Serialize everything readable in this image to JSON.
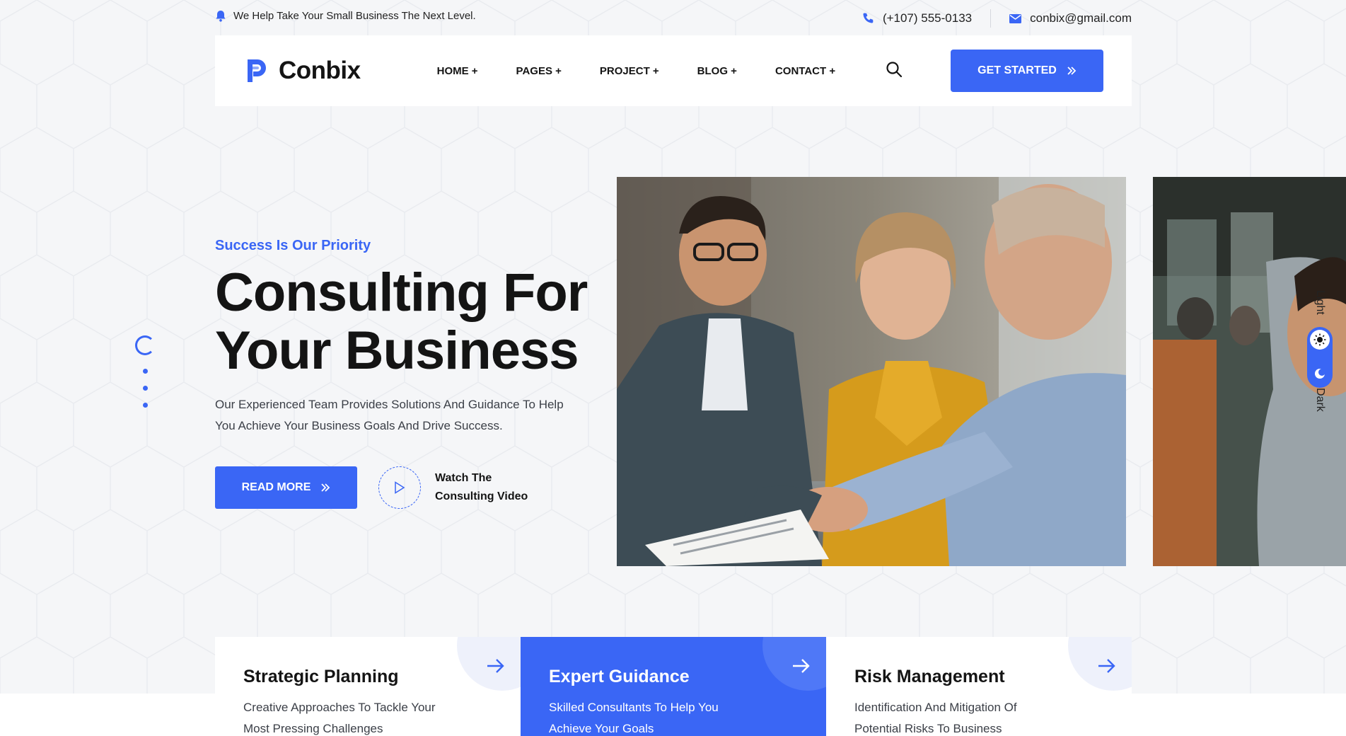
{
  "topbar": {
    "tagline": "We Help Take Your Small Business The Next Level.",
    "phone": "(+107) 555-0133",
    "email": "conbix@gmail.com"
  },
  "header": {
    "logo_text": "Conbix",
    "nav": [
      "HOME +",
      "PAGES +",
      "PROJECT +",
      "BLOG +",
      "CONTACT +"
    ],
    "cta_label": "GET STARTED"
  },
  "hero": {
    "eyebrow": "Success Is Our Priority",
    "title_line1": "Consulting For",
    "title_line2": "Your Business",
    "description": "Our Experienced Team Provides Solutions And Guidance To Help You Achieve Your Business Goals And Drive Success.",
    "read_more": "READ MORE",
    "video_line1": "Watch The",
    "video_line2": "Consulting Video"
  },
  "slider": {
    "slides": 4,
    "active": 1
  },
  "theme_toggle": {
    "light_label": "Light",
    "dark_label": "Dark"
  },
  "features": [
    {
      "title": "Strategic Planning",
      "desc_line1": "Creative Approaches To Tackle Your",
      "desc_line2": "Most Pressing Challenges",
      "active": false
    },
    {
      "title": "Expert Guidance",
      "desc_line1": "Skilled Consultants To Help You",
      "desc_line2": "Achieve Your Goals",
      "active": true
    },
    {
      "title": "Risk Management",
      "desc_line1": "Identification And Mitigation Of",
      "desc_line2": "Potential Risks To Business",
      "active": false
    }
  ],
  "colors": {
    "accent": "#3a66f5",
    "text": "#141414",
    "background": "#f5f6f8"
  },
  "icons": [
    "bell-icon",
    "phone-icon",
    "mail-icon",
    "search-icon",
    "double-chevron-right-icon",
    "play-icon",
    "sun-icon",
    "moon-icon",
    "arrow-right-icon"
  ]
}
